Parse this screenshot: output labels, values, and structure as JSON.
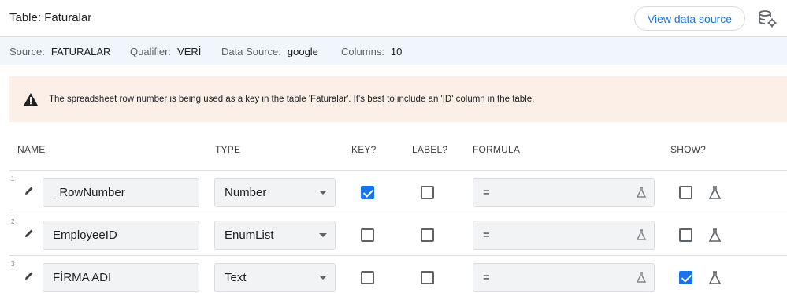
{
  "header": {
    "title": "Table: Faturalar",
    "view_source_label": "View data source"
  },
  "info": {
    "source_label": "Source:",
    "source_value": "FATURALAR",
    "qualifier_label": "Qualifier:",
    "qualifier_value": "VERİ",
    "datasource_label": "Data Source:",
    "datasource_value": "google",
    "columns_label": "Columns:",
    "columns_value": "10"
  },
  "warning": {
    "text": "The spreadsheet row number is being used as a key in the table 'Faturalar'. It's best to include an 'ID' column in the table."
  },
  "columns_header": {
    "name": "NAME",
    "type": "TYPE",
    "key": "KEY?",
    "label": "LABEL?",
    "formula": "FORMULA",
    "show": "SHOW?"
  },
  "rows": [
    {
      "num": "1",
      "name": "_RowNumber",
      "type": "Number",
      "key": true,
      "label": false,
      "formula": "=",
      "show": false
    },
    {
      "num": "2",
      "name": "EmployeeID",
      "type": "EnumList",
      "key": false,
      "label": false,
      "formula": "=",
      "show": false
    },
    {
      "num": "3",
      "name": "FİRMA ADI",
      "type": "Text",
      "key": false,
      "label": false,
      "formula": "=",
      "show": true
    }
  ],
  "colors": {
    "accent": "#1a73e8",
    "warning_bg": "#fbefe7",
    "info_bg": "#f1f5fc"
  }
}
